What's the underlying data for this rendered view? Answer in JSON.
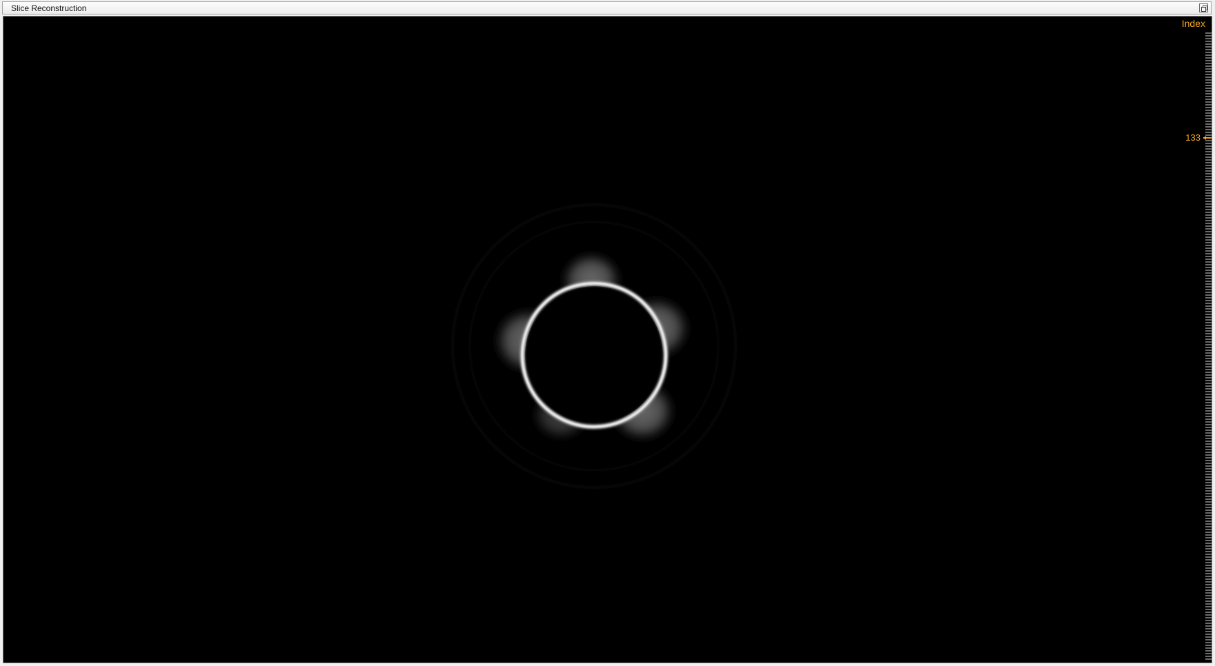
{
  "window": {
    "title": "Slice Reconstruction"
  },
  "viewer": {
    "index_label": "Index",
    "index_value": "133",
    "accent_color": "#f0a51e",
    "background_color": "#000000"
  },
  "icons": {
    "restore": "restore-window-icon"
  }
}
